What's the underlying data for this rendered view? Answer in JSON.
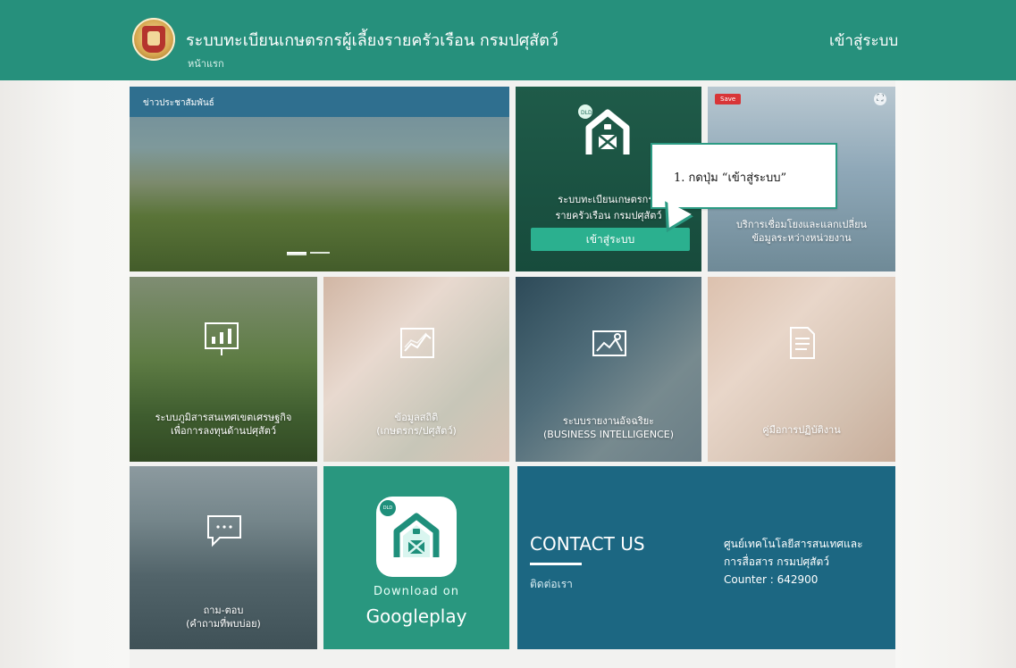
{
  "header": {
    "site_title": "ระบบทะเบียนเกษตรกรผู้เลี้ยงรายครัวเรือน กรมปศุสัตว์",
    "breadcrumb": "หน้าแรก",
    "login": "เข้าสู่ระบบ"
  },
  "tiles": {
    "news": {
      "label": "ข่าวประชาสัมพันธ์"
    },
    "registration": {
      "line1": "ระบบทะเบียนเกษตรกรผู้",
      "line2": "รายครัวเรือน กรมปศุสัตว์",
      "button": "เข้าสู่ระบบ"
    },
    "exchange": {
      "save": "Save",
      "line1": "บริการเชื่อมโยงและแลกเปลี่ยน",
      "line2": "ข้อมูลระหว่างหน่วยงาน"
    },
    "economy": {
      "line1": "ระบบภูมิสารสนเทศเขตเศรษฐกิจ",
      "line2": "เพื่อการลงทุนด้านปศุสัตว์"
    },
    "cattle": {
      "line1": "ข้อมูลสถิติ",
      "line2": "(เกษตรกร/ปศุสัตว์)"
    },
    "business_intelligence": {
      "line1": "ระบบรายงานอัจฉริยะ",
      "line2": "(BUSINESS INTELLIGENCE)"
    },
    "manual": {
      "label": "คู่มือการปฏิบัติงาน"
    },
    "faq": {
      "line1": "ถาม-ตอบ",
      "line2": "(คำถามที่พบบ่อย)"
    },
    "download": {
      "line1": "Download on",
      "line2": "Googleplay"
    },
    "contact": {
      "title": "CONTACT US",
      "subtitle": "ติดต่อเรา",
      "office_line1": "ศูนย์เทคโนโลยีสารสนเทศและ",
      "office_line2": "การสื่อสาร กรมปศุสัตว์",
      "counter": "Counter : 642900"
    }
  },
  "callout": {
    "text": "1. กดปุ่ม “เข้าสู่ระบบ”"
  },
  "colors": {
    "header": "#26907c",
    "news_bar": "#2f6f8f",
    "registration_button": "#2bb08f",
    "download_tile": "#29977f",
    "contact_tile": "#1c6782"
  },
  "icons": [
    "department-seal-icon",
    "farm-barn-icon",
    "bar-chart-icon",
    "line-chart-icon",
    "image-icon",
    "document-icon",
    "chat-bubble-icon",
    "fullscreen-icon",
    "google-play-app-icon"
  ]
}
